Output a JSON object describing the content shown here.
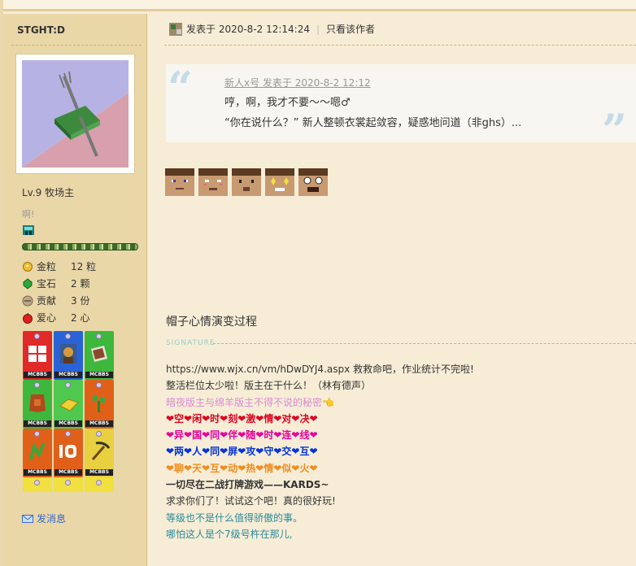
{
  "user": {
    "name": "STGHT:D",
    "level": "Lv.9 牧场主",
    "motto": "啊!",
    "stats": [
      {
        "icon": "gold-nugget-icon",
        "label": "金粒",
        "value": "12 粒"
      },
      {
        "icon": "emerald-icon",
        "label": "宝石",
        "value": "2 颗"
      },
      {
        "icon": "contribution-icon",
        "label": "贡献",
        "value": "3 份"
      },
      {
        "icon": "apple-icon",
        "label": "爱心",
        "value": "2 心"
      }
    ],
    "medal_tag": "MCBBS",
    "send_message": "发消息"
  },
  "post": {
    "posted_at": "发表于 2020-8-2 12:14:24",
    "only_author": "只看该作者",
    "quote": {
      "meta": "新人x号 发表于 2020-8-2 12:12",
      "line1": "哼，啊，我才不要～～嗯♂",
      "line2": "“你在说什么？” 新人整顿衣裳起敛容，疑惑地问道（非ghs）..."
    },
    "caption": "帽子心情演变过程"
  },
  "signature": {
    "label": "SIGNATURE",
    "lines": [
      "https://www.wjx.cn/vm/hDwDYJ4.aspx 救救命吧，作业统计不完啦!",
      "整活栏位太少啦！版主在干什么！（林有德声）",
      "暗夜版主与绵羊版主不得不说的秘密👈",
      "❤空❤闲❤时❤刻❤激❤情❤对❤决❤",
      "❤异❤国❤同❤伴❤随❤时❤连❤线❤",
      "❤两❤人❤同❤屏❤攻❤守❤交❤互❤",
      "❤聊❤天❤互❤动❤热❤情❤似❤火❤",
      "一切尽在二战打牌游戏——KARDS~",
      "求求你们了！试试这个吧！真的很好玩!",
      "等级也不是什么值得骄傲的事。",
      "哪怕这人是个7级号杵在那儿,"
    ]
  },
  "colors": {
    "page_bg": "#f7edd6",
    "sidebar_bg": "#ead7a8",
    "link_blue": "#3366cc",
    "teal": "#2a8a9a"
  }
}
